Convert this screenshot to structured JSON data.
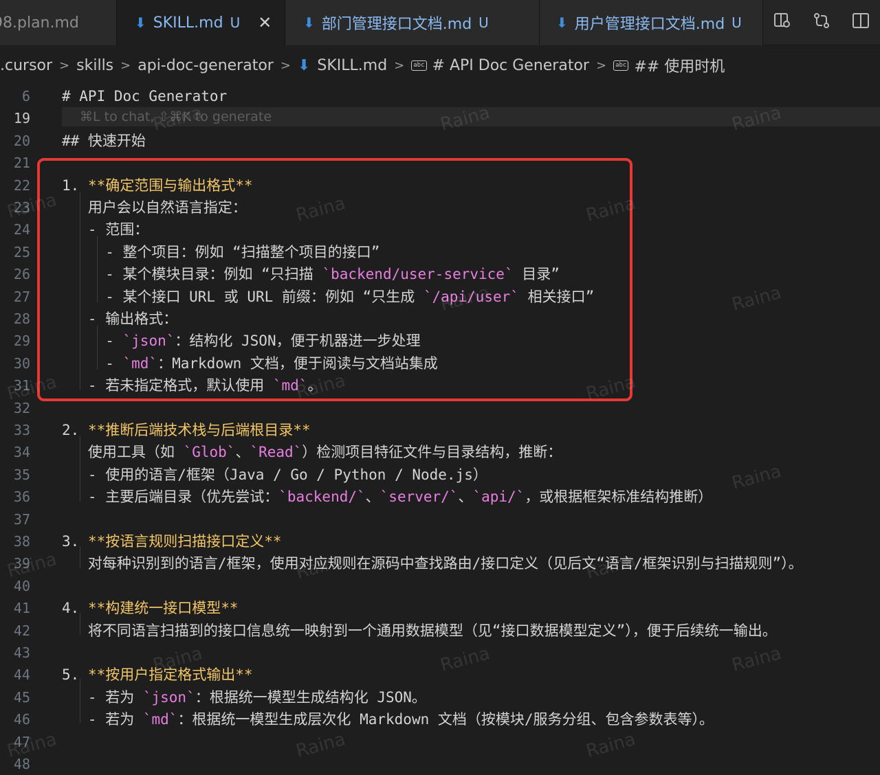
{
  "tabs": [
    {
      "label": "98.plan.md",
      "modified": "",
      "active": false
    },
    {
      "label": "SKILL.md",
      "modified": "U",
      "active": true
    },
    {
      "label": "部门管理接口文档.md",
      "modified": "U",
      "active": false
    },
    {
      "label": "用户管理接口文档.md",
      "modified": "U",
      "active": false
    }
  ],
  "tab_actions": [
    "open-preview-icon",
    "compare-changes-icon",
    "split-editor-icon"
  ],
  "breadcrumb": [
    ".cursor",
    "skills",
    "api-doc-generator",
    "SKILL.md",
    "# API Doc Generator",
    "## 使用时机"
  ],
  "editor": {
    "hint": "⌘L to chat, ⇧⌘K to generate",
    "lines": [
      {
        "n": "6",
        "t": "# API Doc Generator"
      },
      {
        "n": "19",
        "t": ""
      },
      {
        "n": "20",
        "t": "## 快速开始"
      },
      {
        "n": "21",
        "t": ""
      },
      {
        "n": "22",
        "t": "1. **确定范围与输出格式**"
      },
      {
        "n": "23",
        "t": "   用户会以自然语言指定："
      },
      {
        "n": "24",
        "t": "   - 范围："
      },
      {
        "n": "25",
        "t": "     - 整个项目：例如 “扫描整个项目的接口”"
      },
      {
        "n": "26",
        "t": "     - 某个模块目录：例如 “只扫描 `backend/user-service` 目录”"
      },
      {
        "n": "27",
        "t": "     - 某个接口 URL 或 URL 前缀：例如 “只生成 `/api/user` 相关接口”"
      },
      {
        "n": "28",
        "t": "   - 输出格式："
      },
      {
        "n": "29",
        "t": "     - `json`：结构化 JSON，便于机器进一步处理"
      },
      {
        "n": "30",
        "t": "     - `md`：Markdown 文档，便于阅读与文档站集成"
      },
      {
        "n": "31",
        "t": "   - 若未指定格式，默认使用 `md`。"
      },
      {
        "n": "32",
        "t": ""
      },
      {
        "n": "33",
        "t": "2. **推断后端技术栈与后端根目录**"
      },
      {
        "n": "34",
        "t": "   使用工具（如 `Glob`、`Read`）检测项目特征文件与目录结构，推断："
      },
      {
        "n": "35",
        "t": "   - 使用的语言/框架（Java / Go / Python / Node.js）"
      },
      {
        "n": "36",
        "t": "   - 主要后端目录（优先尝试：`backend/`、`server/`、`api/`，或根据框架标准结构推断）"
      },
      {
        "n": "37",
        "t": ""
      },
      {
        "n": "38",
        "t": "3. **按语言规则扫描接口定义**"
      },
      {
        "n": "39",
        "t": "   对每种识别到的语言/框架，使用对应规则在源码中查找路由/接口定义（见后文“语言/框架识别与扫描规则”）。"
      },
      {
        "n": "40",
        "t": ""
      },
      {
        "n": "41",
        "t": "4. **构建统一接口模型**"
      },
      {
        "n": "42",
        "t": "   将不同语言扫描到的接口信息统一映射到一个通用数据模型（见“接口数据模型定义”），便于后续统一输出。"
      },
      {
        "n": "43",
        "t": ""
      },
      {
        "n": "44",
        "t": "5. **按用户指定格式输出**"
      },
      {
        "n": "45",
        "t": "   - 若为 `json`：根据统一模型生成结构化 JSON。"
      },
      {
        "n": "46",
        "t": "   - 若为 `md`：根据统一模型生成层次化 Markdown 文档（按模块/服务分组、包含参数表等）。"
      },
      {
        "n": "47",
        "t": ""
      },
      {
        "n": "48",
        "t": ""
      }
    ]
  },
  "watermark": "Raina",
  "colors": {
    "background": "#1e1e1e",
    "bold_text": "#f2c566",
    "inline_code": "#e87ee0",
    "tab_text": "#89b9f3",
    "highlight_border": "#e53935"
  }
}
